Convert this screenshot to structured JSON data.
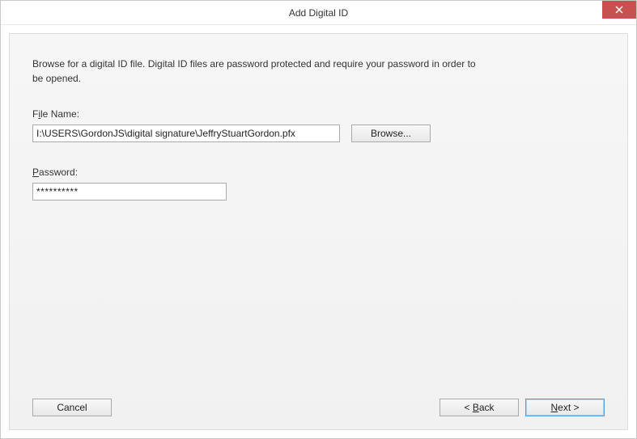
{
  "window": {
    "title": "Add Digital ID"
  },
  "instructions": "Browse for a digital ID file. Digital ID files are password protected and require your password in order to be opened.",
  "file": {
    "label_prefix": "F",
    "label_rest_underline": "i",
    "label_rest": "le Name:",
    "value": "I:\\USERS\\GordonJS\\digital signature\\JeffryStuartGordon.pfx",
    "browse_label": "Browse..."
  },
  "password": {
    "label_underline": "P",
    "label_rest": "assword:",
    "value": "**********"
  },
  "buttons": {
    "cancel": "Cancel",
    "back_prefix": "< ",
    "back_underline": "B",
    "back_rest": "ack",
    "next_underline": "N",
    "next_rest": "ext >"
  }
}
